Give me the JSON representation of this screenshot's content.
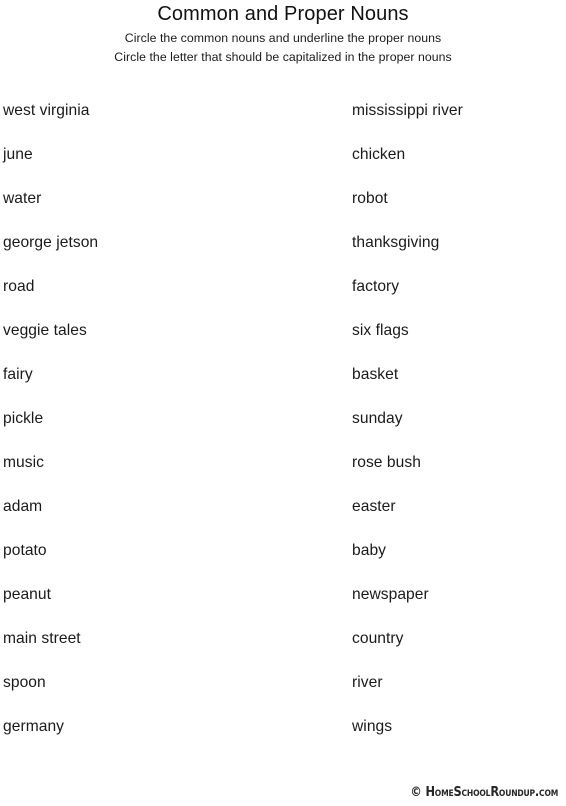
{
  "header": {
    "title": "Common and Proper Nouns",
    "instruction_1": "Circle the common nouns and underline the proper nouns",
    "instruction_2": "Circle the letter that should be capitalized in the proper nouns"
  },
  "columns": {
    "left": [
      "west virginia",
      "june",
      "water",
      "george jetson",
      "road",
      "veggie tales",
      "fairy",
      "pickle",
      "music",
      "adam",
      "potato",
      "peanut",
      "main street",
      "spoon",
      "germany"
    ],
    "right": [
      "mississippi river",
      "chicken",
      "robot",
      "thanksgiving",
      "factory",
      "six flags",
      "basket",
      "sunday",
      "rose bush",
      "easter",
      "baby",
      "newspaper",
      "country",
      "river",
      "wings"
    ]
  },
  "footer": {
    "credit": "© HomeSchoolRoundup.com"
  },
  "colors": {
    "page_background": "#ffffff",
    "text": "#1a1a1a",
    "title": "#111111",
    "footer_text": "#262626"
  }
}
